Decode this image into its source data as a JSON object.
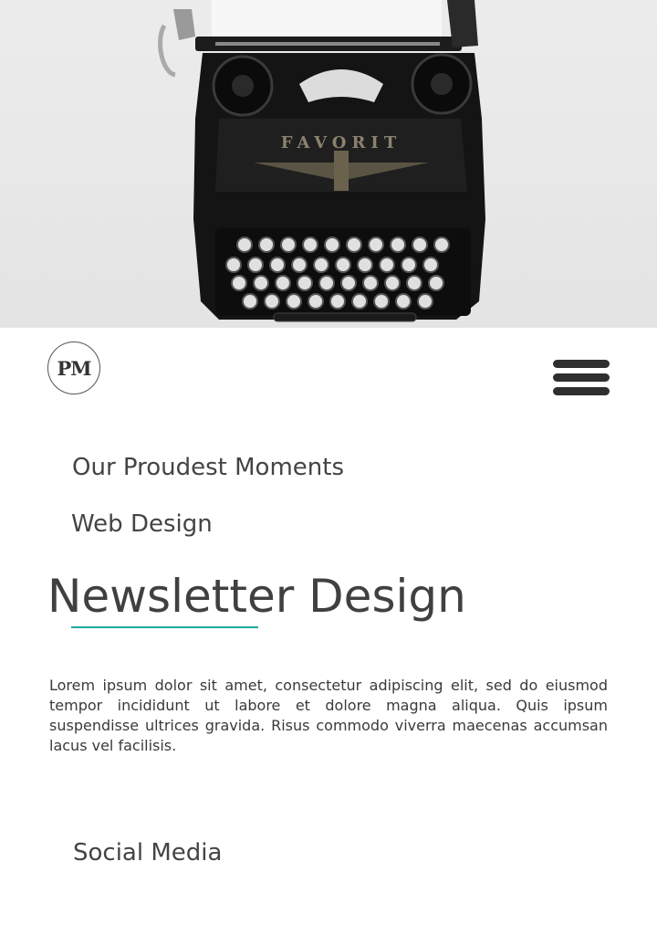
{
  "hero": {
    "image": "typewriter-photo",
    "brand_text": "FAVORIT"
  },
  "header": {
    "logo": "PM",
    "menu_icon": "hamburger-menu-icon"
  },
  "projects": [
    {
      "label": "Our Proudest Moments"
    },
    {
      "label": "Web Design"
    },
    {
      "label": "Newsletter Design",
      "active": true
    },
    {
      "label": "Social Media"
    }
  ],
  "active_project": {
    "description": "Lorem ipsum dolor sit amet, consectetur adipiscing elit, sed do eiusmod tempor incididunt ut labore et dolore magna aliqua. Quis ipsum suspendisse ultrices gravida. Risus commodo viverra maecenas accumsan lacus vel facilisis."
  },
  "colors": {
    "accent": "#1aa89c",
    "text": "#444444",
    "background": "#ffffff"
  }
}
